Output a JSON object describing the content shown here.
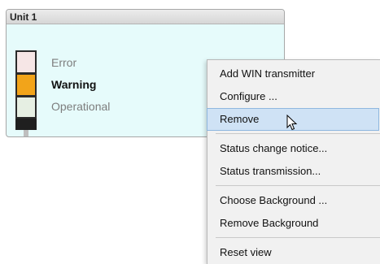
{
  "unit": {
    "title": "Unit 1",
    "statuses": [
      {
        "label": "Error",
        "color": "#f6e6e6",
        "active": false
      },
      {
        "label": "Warning",
        "color": "#f2a41a",
        "active": true
      },
      {
        "label": "Operational",
        "color": "#e6efe3",
        "active": false
      }
    ]
  },
  "context_menu": {
    "items": [
      {
        "label": "Add WIN transmitter"
      },
      {
        "label": "Configure ..."
      },
      {
        "label": "Remove",
        "highlighted": true
      },
      {
        "label": "Status change notice..."
      },
      {
        "label": "Status transmission..."
      },
      {
        "label": "Choose Background ..."
      },
      {
        "label": "Remove Background"
      },
      {
        "label": "Reset view"
      }
    ],
    "cursor_icon": "mouse-pointer-icon"
  },
  "colors": {
    "card_background": "#e6fbfb",
    "menu_highlight": "#cfe2f5",
    "warning": "#f2a41a"
  }
}
